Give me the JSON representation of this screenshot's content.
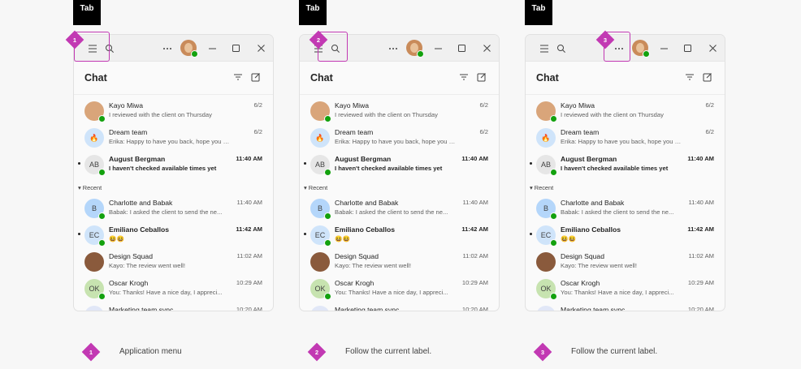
{
  "tab_key": "Tab",
  "chat": {
    "title": "Chat",
    "section_recent": "Recent",
    "pinned": [
      {
        "name": "Kayo Miwa",
        "preview": "I reviewed with the client on Thursday",
        "time": "6/2",
        "unread": false,
        "avatar": "photo"
      },
      {
        "name": "Dream team",
        "preview": "Erika: Happy to have you back, hope you had...",
        "time": "6/2",
        "unread": false,
        "avatar": "group-flame"
      },
      {
        "name": "August Bergman",
        "preview": "I haven't checked available times yet",
        "time": "11:40 AM",
        "unread": true,
        "avatar": "AB"
      }
    ],
    "recent": [
      {
        "name": "Charlotte and Babak",
        "preview": "Babak: I asked the client to send the ne...",
        "time": "11:40 AM",
        "unread": false,
        "avatar": "B"
      },
      {
        "name": "Emiliano Ceballos",
        "preview": "😆😆",
        "time": "11:42 AM",
        "unread": true,
        "avatar": "EC"
      },
      {
        "name": "Design Squad",
        "preview": "Kayo: The review went well!",
        "time": "11:02 AM",
        "unread": false,
        "avatar": "photo-group"
      },
      {
        "name": "Oscar Krogh",
        "preview": "You: Thanks! Have a nice day, I appreci...",
        "time": "10:29 AM",
        "unread": false,
        "avatar": "OK"
      },
      {
        "name": "Marketing team sync",
        "preview": "",
        "time": "10:20 AM",
        "unread": false,
        "avatar": "calendar"
      }
    ]
  },
  "steps": [
    {
      "number": "1",
      "legend": "Application menu"
    },
    {
      "number": "2",
      "legend": "Follow the current label."
    },
    {
      "number": "3",
      "legend": "Follow the current label."
    }
  ],
  "colors": {
    "focus": "#c239b3",
    "presence": "#13a10e"
  },
  "icons": {
    "menu": "hamburger-icon",
    "search": "search-icon",
    "more": "more-options-icon",
    "minimize": "minimize-icon",
    "maximize": "maximize-icon",
    "close": "close-icon",
    "filter": "filter-icon",
    "compose": "compose-icon"
  }
}
